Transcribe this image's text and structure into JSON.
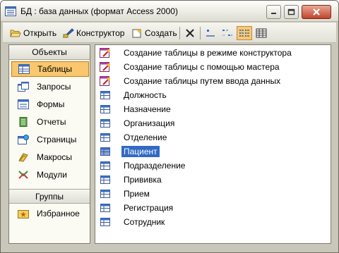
{
  "window": {
    "title": "БД : база данных (формат Access 2000)",
    "close_color": "#c0442b"
  },
  "toolbar": {
    "open_label": "Открыть",
    "open_hotkey": "О",
    "design_label": "Конструктор",
    "design_hotkey": "К",
    "create_label": "Создать",
    "create_hotkey": "ь",
    "icons": [
      "delete-icon",
      "large-icons-icon",
      "small-icons-icon",
      "list-view-icon",
      "details-view-icon"
    ]
  },
  "sidebar": {
    "objects_header": "Объекты",
    "items": [
      {
        "label": "Таблицы",
        "icon": "table-icon",
        "selected": true
      },
      {
        "label": "Запросы",
        "icon": "query-icon",
        "selected": false
      },
      {
        "label": "Формы",
        "icon": "form-icon",
        "selected": false
      },
      {
        "label": "Отчеты",
        "icon": "report-icon",
        "selected": false
      },
      {
        "label": "Страницы",
        "icon": "page-icon",
        "selected": false
      },
      {
        "label": "Макросы",
        "icon": "macro-icon",
        "selected": false
      },
      {
        "label": "Модули",
        "icon": "module-icon",
        "selected": false
      }
    ],
    "groups_header": "Группы",
    "group_items": [
      {
        "label": "Избранное",
        "icon": "favorites-icon"
      }
    ],
    "selected_color": "#f8c76e"
  },
  "list": {
    "items": [
      {
        "label": "Создание таблицы в режиме конструктора",
        "icon": "wizard-icon"
      },
      {
        "label": "Создание таблицы с помощью мастера",
        "icon": "wizard-icon"
      },
      {
        "label": "Создание таблицы путем ввода данных",
        "icon": "wizard-icon"
      },
      {
        "label": "Должность",
        "icon": "table-icon"
      },
      {
        "label": "Назначение",
        "icon": "table-icon"
      },
      {
        "label": "Организация",
        "icon": "table-icon"
      },
      {
        "label": "Отделение",
        "icon": "table-icon"
      },
      {
        "label": "Пациент",
        "icon": "table-icon",
        "selected": true
      },
      {
        "label": "Подразделение",
        "icon": "table-icon"
      },
      {
        "label": "Прививка",
        "icon": "table-icon"
      },
      {
        "label": "Прием",
        "icon": "table-icon"
      },
      {
        "label": "Регистрация",
        "icon": "table-icon"
      },
      {
        "label": "Сотрудник",
        "icon": "table-icon"
      }
    ],
    "selection_color": "#316ac5"
  }
}
